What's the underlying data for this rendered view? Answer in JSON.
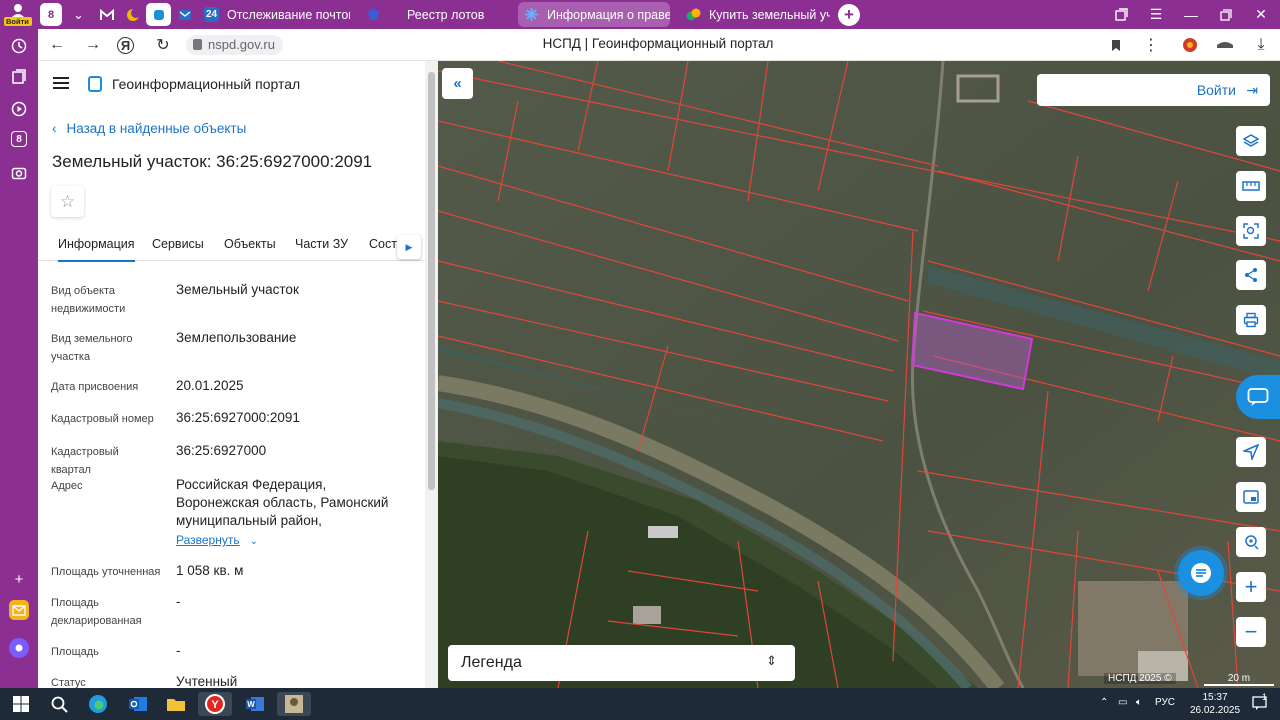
{
  "browser": {
    "profile_badge": "Войти",
    "tab_counter": "8",
    "tabs": [
      {
        "label": "Отслеживание почтового",
        "color": "#2a6cc6"
      },
      {
        "label": "Реестр лотов",
        "color": "#3b5bd9"
      },
      {
        "label": "Информация о праве",
        "color": "#2f6ee0",
        "active": true
      },
      {
        "label": "Купить земельный участ",
        "color": "#21a866"
      }
    ],
    "url": "nspd.gov.ru",
    "page_title": "НСПД | Геоинформационный портал"
  },
  "sidestrip": {
    "counter": "8"
  },
  "panel": {
    "portal_title": "Геоинформационный портал",
    "back_link": "Назад в найденные объекты",
    "object_title": "Земельный участок: 36:25:6927000:2091",
    "tabs": [
      "Информация",
      "Сервисы",
      "Объекты",
      "Части ЗУ",
      "Соста"
    ],
    "rows": [
      {
        "label": "Вид объекта недвижимости",
        "value": "Земельный участок"
      },
      {
        "label": "Вид земельного участка",
        "value": "Землепользование"
      },
      {
        "label": "Дата присвоения",
        "value": "20.01.2025"
      },
      {
        "label": "Кадастровый номер",
        "value": "36:25:6927000:2091"
      },
      {
        "label": "Кадастровый квартал",
        "value": "36:25:6927000"
      },
      {
        "label": "Адрес",
        "value": "Российская Федерация, Воронежская область, Рамонский муниципальный район,"
      },
      {
        "label": "Площадь уточненная",
        "value": "1 058 кв. м"
      },
      {
        "label": "Площадь декларированная",
        "value": "-"
      },
      {
        "label": "Площадь",
        "value": "-"
      },
      {
        "label": "Статус",
        "value": "Учтенный"
      }
    ],
    "expand_label": "Развернуть"
  },
  "map": {
    "login_label": "Войти",
    "legend_label": "Легенда",
    "copyright": "НСПД 2025 ©",
    "scale": "20 m",
    "parcel_color": "#e0463a",
    "selected_color": "#d23ad8"
  },
  "taskbar": {
    "lang": "РУС",
    "time": "15:37",
    "date": "26.02.2025",
    "notifications": "1"
  }
}
